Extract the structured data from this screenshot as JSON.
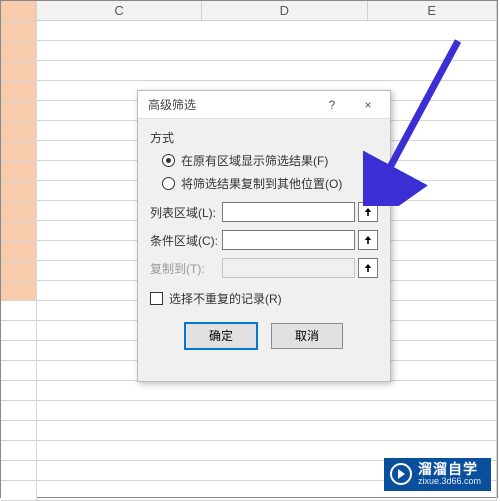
{
  "columns": {
    "c": "C",
    "d": "D",
    "e": "E"
  },
  "dialog": {
    "title": "高级筛选",
    "help": "?",
    "close": "×",
    "method_label": "方式",
    "radio_inplace": "在原有区域显示筛选结果(F)",
    "radio_copy": "将筛选结果复制到其他位置(O)",
    "list_range_label": "列表区域(L):",
    "criteria_range_label": "条件区域(C):",
    "copy_to_label": "复制到(T):",
    "unique_label": "选择不重复的记录(R)",
    "ok": "确定",
    "cancel": "取消"
  },
  "watermark": {
    "main": "溜溜自学",
    "sub": "zixue.3d66.com"
  }
}
